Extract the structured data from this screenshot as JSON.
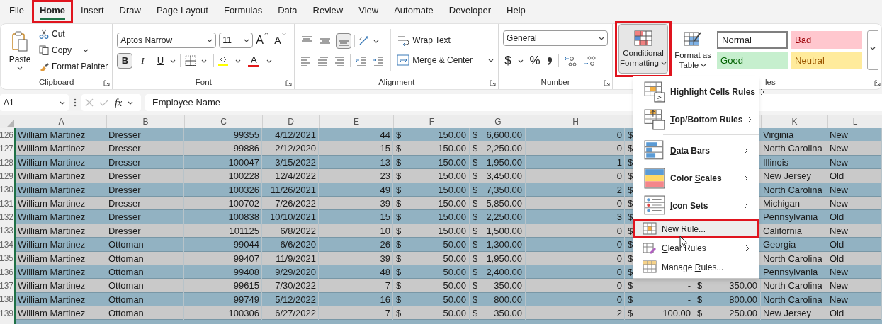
{
  "tabs": [
    {
      "label": "File",
      "selected": false,
      "annotated": false
    },
    {
      "label": "Home",
      "selected": true,
      "annotated": true
    },
    {
      "label": "Insert",
      "selected": false,
      "annotated": false
    },
    {
      "label": "Draw",
      "selected": false,
      "annotated": false
    },
    {
      "label": "Page Layout",
      "selected": false,
      "annotated": false
    },
    {
      "label": "Formulas",
      "selected": false,
      "annotated": false
    },
    {
      "label": "Data",
      "selected": false,
      "annotated": false
    },
    {
      "label": "Review",
      "selected": false,
      "annotated": false
    },
    {
      "label": "View",
      "selected": false,
      "annotated": false
    },
    {
      "label": "Automate",
      "selected": false,
      "annotated": false
    },
    {
      "label": "Developer",
      "selected": false,
      "annotated": false
    },
    {
      "label": "Help",
      "selected": false,
      "annotated": false
    }
  ],
  "clipboard": {
    "label": "Clipboard",
    "paste": "Paste",
    "cut": "Cut",
    "copy": "Copy",
    "format_painter": "Format Painter"
  },
  "font": {
    "label": "Font",
    "family": "Aptos Narrow",
    "size": "11",
    "grow": "A",
    "shrink": "A",
    "font_color": "A",
    "toggles": [
      {
        "label": "B",
        "kind": "bold",
        "selected": true
      },
      {
        "label": "I",
        "kind": "italic",
        "selected": false
      },
      {
        "label": "U",
        "kind": "underline",
        "selected": false
      }
    ]
  },
  "alignment": {
    "label": "Alignment",
    "wrap_text": "Wrap Text",
    "merge_center": "Merge & Center",
    "vertical": [
      {
        "kind": "top",
        "selected": false
      },
      {
        "kind": "middle",
        "selected": false
      },
      {
        "kind": "bottom",
        "selected": true
      }
    ]
  },
  "number": {
    "label": "Number",
    "format": "General",
    "currency": "$",
    "percent": "%"
  },
  "styles": {
    "label": "les",
    "conditional_formatting": {
      "label": "Conditional Formatting",
      "selected": true,
      "annotated": true
    },
    "format_as_table": "Format as Table",
    "cell_styles": [
      {
        "label": "Normal",
        "kind": "normal"
      },
      {
        "label": "Bad",
        "kind": "bad"
      },
      {
        "label": "Good",
        "kind": "good"
      },
      {
        "label": "Neutral",
        "kind": "neutral"
      }
    ]
  },
  "formula_bar": {
    "name_box": "A1",
    "fx": "fx",
    "formula": "Employee Name"
  },
  "menu": {
    "items": [
      {
        "kind": "large",
        "parts": {
          "key": "H",
          "after": "ighlight Cells Rules"
        },
        "submenu": true,
        "highlighted": false,
        "annotated": false
      },
      {
        "kind": "large",
        "parts": {
          "key": "T",
          "after": "op/Bottom Rules"
        },
        "submenu": true,
        "highlighted": false,
        "annotated": false
      },
      {
        "kind": "separator"
      },
      {
        "kind": "large",
        "parts": {
          "key": "D",
          "after": "ata Bars"
        },
        "submenu": true,
        "highlighted": false,
        "annotated": false
      },
      {
        "kind": "large",
        "parts": {
          "before": "Color ",
          "key": "S",
          "after": "cales"
        },
        "submenu": true,
        "highlighted": false,
        "annotated": false
      },
      {
        "kind": "large",
        "parts": {
          "key": "I",
          "after": "con Sets"
        },
        "submenu": true,
        "highlighted": false,
        "annotated": false
      },
      {
        "kind": "small",
        "parts": {
          "key": "N",
          "after": "ew Rule..."
        },
        "submenu": false,
        "highlighted": true,
        "annotated": true
      },
      {
        "kind": "small",
        "parts": {
          "key": "C",
          "after": "lear Rules"
        },
        "submenu": true,
        "highlighted": false,
        "annotated": false
      },
      {
        "kind": "small",
        "parts": {
          "before": "Manage ",
          "key": "R",
          "after": "ules..."
        },
        "submenu": false,
        "highlighted": false,
        "annotated": false
      }
    ]
  },
  "sheet": {
    "columns": {
      "A": "A",
      "B": "B",
      "C": "C",
      "D": "D",
      "E": "E",
      "F": "F",
      "G": "G",
      "H": "H",
      "K": "K",
      "L": "L"
    },
    "rows": [
      {
        "row": "126",
        "A": "William Martinez",
        "B": "Dresser",
        "C": "99355",
        "D": "4/12/2021",
        "E": "44",
        "F": [
          "$",
          "150.00"
        ],
        "G": [
          "$",
          "6,600.00"
        ],
        "H": "0",
        "I": [
          "$"
        ],
        "K": "Virginia",
        "L": "New"
      },
      {
        "row": "127",
        "A": "William Martinez",
        "B": "Dresser",
        "C": "99886",
        "D": "2/12/2020",
        "E": "15",
        "F": [
          "$",
          "150.00"
        ],
        "G": [
          "$",
          "2,250.00"
        ],
        "H": "0",
        "I": [
          "$"
        ],
        "K": "North Carolina",
        "L": "New"
      },
      {
        "row": "128",
        "A": "William Martinez",
        "B": "Dresser",
        "C": "100047",
        "D": "3/15/2022",
        "E": "13",
        "F": [
          "$",
          "150.00"
        ],
        "G": [
          "$",
          "1,950.00"
        ],
        "H": "1",
        "I": [
          "$"
        ],
        "K": "Illinois",
        "L": "New"
      },
      {
        "row": "129",
        "A": "William Martinez",
        "B": "Dresser",
        "C": "100228",
        "D": "12/4/2022",
        "E": "23",
        "F": [
          "$",
          "150.00"
        ],
        "G": [
          "$",
          "3,450.00"
        ],
        "H": "0",
        "I": [
          "$"
        ],
        "K": "New Jersey",
        "L": "Old"
      },
      {
        "row": "130",
        "A": "William Martinez",
        "B": "Dresser",
        "C": "100326",
        "D": "11/26/2021",
        "E": "49",
        "F": [
          "$",
          "150.00"
        ],
        "G": [
          "$",
          "7,350.00"
        ],
        "H": "2",
        "I": [
          "$"
        ],
        "K": "North Carolina",
        "L": "New"
      },
      {
        "row": "131",
        "A": "William Martinez",
        "B": "Dresser",
        "C": "100702",
        "D": "7/26/2022",
        "E": "39",
        "F": [
          "$",
          "150.00"
        ],
        "G": [
          "$",
          "5,850.00"
        ],
        "H": "0",
        "I": [
          "$"
        ],
        "K": "Michigan",
        "L": "New"
      },
      {
        "row": "132",
        "A": "William Martinez",
        "B": "Dresser",
        "C": "100838",
        "D": "10/10/2021",
        "E": "15",
        "F": [
          "$",
          "150.00"
        ],
        "G": [
          "$",
          "2,250.00"
        ],
        "H": "3",
        "I": [
          "$"
        ],
        "K": "Pennsylvania",
        "L": "Old"
      },
      {
        "row": "133",
        "A": "William Martinez",
        "B": "Dresser",
        "C": "101125",
        "D": "6/8/2022",
        "E": "10",
        "F": [
          "$",
          "150.00"
        ],
        "G": [
          "$",
          "1,500.00"
        ],
        "H": "0",
        "I": [
          "$"
        ],
        "K": "California",
        "L": "New"
      },
      {
        "row": "134",
        "A": "William Martinez",
        "B": "Ottoman",
        "C": "99044",
        "D": "6/6/2020",
        "E": "26",
        "F": [
          "$",
          "50.00"
        ],
        "G": [
          "$",
          "1,300.00"
        ],
        "H": "0",
        "I": [
          "$"
        ],
        "K": "Georgia",
        "L": "Old"
      },
      {
        "row": "135",
        "A": "William Martinez",
        "B": "Ottoman",
        "C": "99407",
        "D": "11/9/2021",
        "E": "39",
        "F": [
          "$",
          "50.00"
        ],
        "G": [
          "$",
          "1,950.00"
        ],
        "H": "0",
        "I": [
          "$"
        ],
        "K": "North Carolina",
        "L": "Old"
      },
      {
        "row": "136",
        "A": "William Martinez",
        "B": "Ottoman",
        "C": "99408",
        "D": "9/29/2020",
        "E": "48",
        "F": [
          "$",
          "50.00"
        ],
        "G": [
          "$",
          "2,400.00"
        ],
        "H": "0",
        "I": [
          "$"
        ],
        "K": "Pennsylvania",
        "L": "New"
      },
      {
        "row": "137",
        "A": "William Martinez",
        "B": "Ottoman",
        "C": "99615",
        "D": "7/30/2022",
        "E": "7",
        "F": [
          "$",
          "50.00"
        ],
        "G": [
          "$",
          "350.00"
        ],
        "H": "0",
        "I": [
          "$",
          "-"
        ],
        "J": [
          "$",
          "350.00"
        ],
        "K": "North Carolina",
        "L": "New"
      },
      {
        "row": "138",
        "A": "William Martinez",
        "B": "Ottoman",
        "C": "99749",
        "D": "5/12/2022",
        "E": "16",
        "F": [
          "$",
          "50.00"
        ],
        "G": [
          "$",
          "800.00"
        ],
        "H": "0",
        "I": [
          "$",
          "-"
        ],
        "J": [
          "$",
          "800.00"
        ],
        "K": "North Carolina",
        "L": "New"
      },
      {
        "row": "139",
        "A": "William Martinez",
        "B": "Ottoman",
        "C": "100306",
        "D": "6/27/2022",
        "E": "7",
        "F": [
          "$",
          "50.00"
        ],
        "G": [
          "$",
          "350.00"
        ],
        "H": "2",
        "I": [
          "$",
          "100.00"
        ],
        "J": [
          "$",
          "250.00"
        ],
        "K": "New Jersey",
        "L": "Old"
      }
    ]
  }
}
